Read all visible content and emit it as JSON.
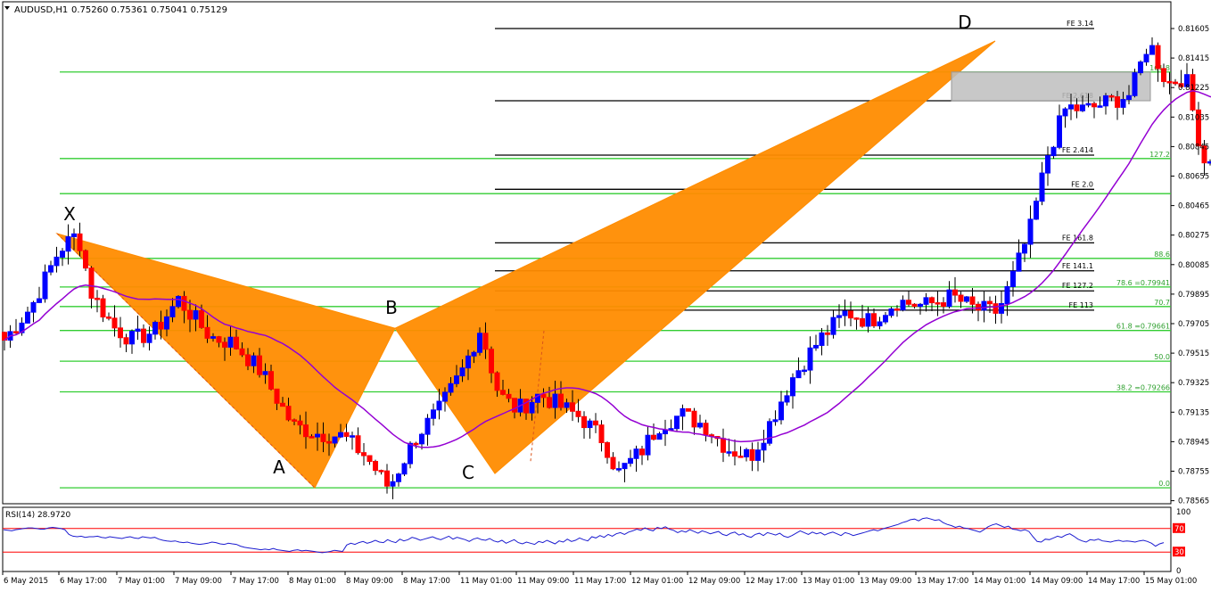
{
  "header": {
    "symbol_text": "AUDUSD,H1",
    "ohlc_text": "0.75260 0.75361 0.75041 0.75129"
  },
  "colors": {
    "bull": "#0000ff",
    "bear": "#ff0000",
    "fib_green": "#32cd32",
    "fe_black": "#000000",
    "ma": "#9400d3",
    "pattern": "#ff8c00",
    "rsi": "#1c1cd0",
    "rsi_level": "#ff0000",
    "zone": "#bebebe"
  },
  "chart_data": {
    "type": "candlestick",
    "y_ticks": [
      "0.81605",
      "0.81415",
      "0.81225",
      "0.81035",
      "0.80845",
      "0.80655",
      "0.80465",
      "0.80275",
      "0.80085",
      "0.79895",
      "0.79705",
      "0.79515",
      "0.79325",
      "0.79135",
      "0.78945",
      "0.78755",
      "0.78565"
    ],
    "x_ticks": [
      "6 May 2015",
      "6 May 17:00",
      "7 May 01:00",
      "7 May 09:00",
      "7 May 17:00",
      "8 May 01:00",
      "8 May 09:00",
      "8 May 17:00",
      "11 May 01:00",
      "11 May 09:00",
      "11 May 17:00",
      "12 May 01:00",
      "12 May 09:00",
      "12 May 17:00",
      "13 May 01:00",
      "13 May 09:00",
      "13 May 17:00",
      "14 May 01:00",
      "14 May 09:00",
      "14 May 17:00",
      "15 May 01:00"
    ],
    "fib_retracement": [
      {
        "label": "161.8",
        "price": 0.81325
      },
      {
        "label": "127.2",
        "price": 0.80768
      },
      {
        "label": "",
        "price": 0.80542
      },
      {
        "label": "88.6",
        "price": 0.80125
      },
      {
        "label": "78.6 =0.79941",
        "price": 0.79941
      },
      {
        "label": "70.7",
        "price": 0.79815
      },
      {
        "label": "61.8 =0.79661",
        "price": 0.79661
      },
      {
        "label": "50.0",
        "price": 0.79463
      },
      {
        "label": "38.2 =0.79266",
        "price": 0.79266
      },
      {
        "label": "0.0",
        "price": 0.78648
      }
    ],
    "fib_extension": [
      {
        "label": "FE 3.14",
        "price": 0.81605
      },
      {
        "label": "FE 2.618",
        "price": 0.8114
      },
      {
        "label": "FE 2.414",
        "price": 0.8079
      },
      {
        "label": "FE 2.0",
        "price": 0.8057
      },
      {
        "label": "FE 161.8",
        "price": 0.80225
      },
      {
        "label": "FE 141.1",
        "price": 0.80045
      },
      {
        "label": "FE 127.2",
        "price": 0.79916
      },
      {
        "label": "FE 113",
        "price": 0.79792
      }
    ],
    "pattern_points": [
      {
        "label": "X",
        "time": "6 May 17:00",
        "price": 0.80285
      },
      {
        "label": "A",
        "time": "8 May 01:00",
        "price": 0.78648
      },
      {
        "label": "B",
        "time": "8 May 15:00",
        "price": 0.79675
      },
      {
        "label": "C",
        "time": "11 May 03:00",
        "price": 0.7874
      },
      {
        "label": "D",
        "time": "14 May 01:00",
        "price": 0.81525
      }
    ],
    "rsi": {
      "label": "RSI(14) 28.9720",
      "value": 28.972,
      "levels": [
        70,
        30
      ],
      "axis_labels": [
        "100",
        "70",
        "30",
        "0"
      ],
      "values": [
        68,
        67,
        66,
        68,
        69,
        70,
        71,
        71,
        70,
        69,
        69,
        71,
        72,
        71,
        70,
        68,
        60,
        57,
        56,
        57,
        55,
        56,
        56,
        57,
        55,
        54,
        56,
        55,
        54,
        53,
        55,
        56,
        54,
        53,
        56,
        55,
        54,
        55,
        52,
        50,
        49,
        48,
        49,
        47,
        46,
        47,
        45,
        44,
        43,
        44,
        45,
        47,
        46,
        44,
        43,
        45,
        44,
        43,
        40,
        38,
        37,
        36,
        35,
        34,
        35,
        34,
        36,
        34,
        33,
        32,
        31,
        33,
        34,
        32,
        33,
        32,
        31,
        30,
        29,
        30,
        31,
        33,
        32,
        31,
        42,
        45,
        43,
        46,
        48,
        45,
        47,
        50,
        47,
        46,
        51,
        48,
        46,
        52,
        49,
        51,
        55,
        53,
        50,
        52,
        54,
        56,
        53,
        51,
        54,
        57,
        52,
        55,
        53,
        51,
        48,
        52,
        54,
        51,
        50,
        53,
        49,
        47,
        50,
        45,
        48,
        51,
        46,
        44,
        47,
        45,
        43,
        48,
        46,
        50,
        47,
        44,
        49,
        47,
        52,
        48,
        50,
        54,
        51,
        49,
        56,
        54,
        58,
        55,
        60,
        57,
        61,
        63,
        60,
        64,
        66,
        69,
        67,
        71,
        68,
        66,
        72,
        70,
        73,
        69,
        67,
        63,
        66,
        64,
        68,
        65,
        62,
        66,
        64,
        61,
        63,
        65,
        60,
        58,
        62,
        64,
        59,
        61,
        57,
        55,
        60,
        62,
        58,
        63,
        61,
        59,
        62,
        57,
        55,
        58,
        62,
        66,
        63,
        60,
        64,
        61,
        63,
        59,
        62,
        64,
        61,
        58,
        63,
        61,
        58,
        60,
        62,
        64,
        66,
        68,
        66,
        69,
        71,
        73,
        75,
        77,
        80,
        82,
        85,
        86,
        83,
        87,
        88,
        86,
        84,
        85,
        80,
        77,
        75,
        72,
        74,
        71,
        70,
        68,
        66,
        64,
        68,
        73,
        76,
        78,
        75,
        72,
        74,
        69,
        68,
        66,
        68,
        65,
        56,
        48,
        47,
        52,
        51,
        54,
        57,
        55,
        59,
        61,
        57,
        52,
        49,
        47,
        51,
        50,
        52,
        49,
        48,
        47,
        49,
        50,
        48,
        49,
        48,
        47,
        49,
        50,
        48,
        45,
        40,
        44,
        46
      ]
    }
  }
}
